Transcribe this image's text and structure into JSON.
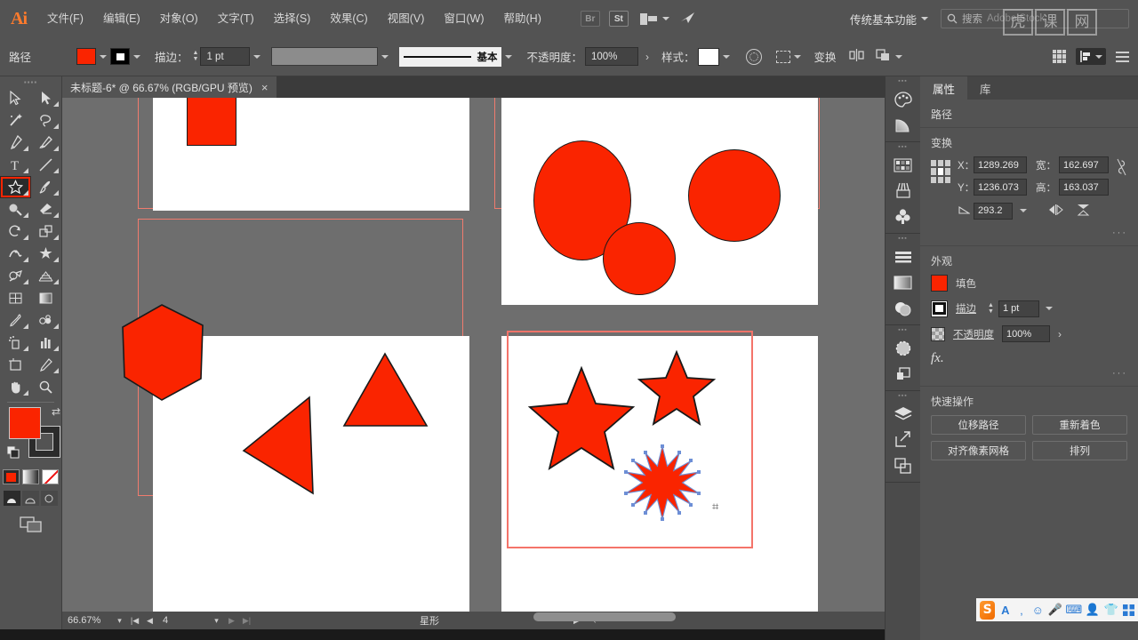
{
  "app": {
    "name": "Ai",
    "workspace": "传统基本功能",
    "watermark": [
      "虎",
      "课",
      "网"
    ]
  },
  "menubar": {
    "items": [
      {
        "label": "文件(F)"
      },
      {
        "label": "编辑(E)"
      },
      {
        "label": "对象(O)"
      },
      {
        "label": "文字(T)"
      },
      {
        "label": "选择(S)"
      },
      {
        "label": "效果(C)"
      },
      {
        "label": "视图(V)"
      },
      {
        "label": "窗口(W)"
      },
      {
        "label": "帮助(H)"
      }
    ],
    "apps": [
      {
        "name": "bridge-icon",
        "label": "Br"
      },
      {
        "name": "stock-icon",
        "label": "St"
      }
    ],
    "search": {
      "label": "搜索",
      "hint": "Adobe Stock"
    }
  },
  "controlbar": {
    "object_type": "路径",
    "fill_color": "#fa2400",
    "stroke_label": "描边：",
    "stroke_weight": "1 pt",
    "stroke_profile_placeholder": "",
    "stroke_style_name": "基本",
    "opacity_label": "不透明度：",
    "opacity_value": "100%",
    "style_label": "样式：",
    "transform_label": "变换",
    "icons": [
      "recolor-artwork-icon",
      "artboard-icon",
      "align-icon",
      "arrange-icon",
      "grid-icon",
      "align-panel-icon",
      "options-menu-icon"
    ]
  },
  "document": {
    "tab_title": "未标题-6* @ 66.67% (RGB/GPU 预览)",
    "close_label": "×"
  },
  "toolbar": {
    "tools": [
      {
        "name": "selection-tool",
        "glyph": "arrow"
      },
      {
        "name": "direct-selection-tool",
        "glyph": "arrow-white"
      },
      {
        "name": "magic-wand-tool",
        "glyph": "wand"
      },
      {
        "name": "lasso-tool",
        "glyph": "lasso"
      },
      {
        "name": "pen-tool",
        "glyph": "pen"
      },
      {
        "name": "curvature-tool",
        "glyph": "curvature"
      },
      {
        "name": "type-tool",
        "glyph": "T"
      },
      {
        "name": "line-segment-tool",
        "glyph": "line"
      },
      {
        "name": "star-tool",
        "glyph": "star",
        "selected": true
      },
      {
        "name": "paintbrush-tool",
        "glyph": "brush"
      },
      {
        "name": "shaper-tool",
        "glyph": "shaper"
      },
      {
        "name": "eraser-tool",
        "glyph": "eraser"
      },
      {
        "name": "rotate-tool",
        "glyph": "rotate"
      },
      {
        "name": "scale-tool",
        "glyph": "scale"
      },
      {
        "name": "width-tool",
        "glyph": "width"
      },
      {
        "name": "free-transform-tool",
        "glyph": "freetransform"
      },
      {
        "name": "shape-builder-tool",
        "glyph": "shapebuilder"
      },
      {
        "name": "perspective-grid-tool",
        "glyph": "perspective"
      },
      {
        "name": "mesh-tool",
        "glyph": "mesh"
      },
      {
        "name": "gradient-tool",
        "glyph": "gradient"
      },
      {
        "name": "eyedropper-tool",
        "glyph": "eyedropper"
      },
      {
        "name": "blend-tool",
        "glyph": "blend"
      },
      {
        "name": "symbol-sprayer-tool",
        "glyph": "symbolsprayer"
      },
      {
        "name": "column-graph-tool",
        "glyph": "graph"
      },
      {
        "name": "artboard-tool",
        "glyph": "artboard"
      },
      {
        "name": "slice-tool",
        "glyph": "slice"
      },
      {
        "name": "hand-tool",
        "glyph": "hand"
      },
      {
        "name": "zoom-tool",
        "glyph": "zoom"
      }
    ],
    "fill_color": "#fa2400",
    "stroke_color": "#000000",
    "color_modes": [
      "color-swatch",
      "gradient-swatch",
      "none-swatch"
    ],
    "draw_modes": [
      "draw-normal",
      "draw-behind",
      "draw-inside"
    ],
    "screen_mode": "change-screen-mode"
  },
  "canvas": {
    "artboards": [
      {
        "name": "artboard-1-squares",
        "shapes": [
          {
            "type": "square",
            "name": "red-square"
          }
        ]
      },
      {
        "name": "artboard-2-ellipses",
        "shapes": [
          {
            "type": "ellipse",
            "name": "red-ellipse-large"
          },
          {
            "type": "circle",
            "name": "red-circle-small"
          },
          {
            "type": "circle",
            "name": "red-circle-right"
          }
        ]
      },
      {
        "name": "artboard-3-polygons",
        "shapes": [
          {
            "type": "hexagon",
            "name": "red-hexagon"
          },
          {
            "type": "triangle-left",
            "name": "red-triangle-left"
          },
          {
            "type": "triangle-up",
            "name": "red-triangle-up"
          }
        ]
      },
      {
        "name": "artboard-4-stars",
        "active": true,
        "shapes": [
          {
            "type": "star-5",
            "name": "red-star-large"
          },
          {
            "type": "star-5",
            "name": "red-star-small"
          },
          {
            "type": "star-11",
            "name": "red-starburst-selected",
            "selected": true
          }
        ]
      }
    ],
    "artboard_guide_color": "#f07b6e",
    "shape_fill": "#fa2400",
    "shape_stroke": "#1a1a1a",
    "background": "#6e6e6e"
  },
  "statusbar": {
    "zoom": "66.67%",
    "page": "4",
    "tool_name": "星形"
  },
  "rail": {
    "groups": [
      {
        "icons": [
          {
            "name": "color-panel-icon"
          },
          {
            "name": "gradient-panel-icon"
          }
        ]
      },
      {
        "icons": [
          {
            "name": "swatches-panel-icon"
          },
          {
            "name": "brushes-panel-icon"
          },
          {
            "name": "symbols-panel-icon"
          }
        ]
      },
      {
        "icons": [
          {
            "name": "align-panel-icon"
          },
          {
            "name": "transparency-panel-icon"
          },
          {
            "name": "appearance-panel-icon"
          }
        ]
      },
      {
        "icons": [
          {
            "name": "stroke-panel-icon"
          },
          {
            "name": "pathfinder-panel-icon"
          }
        ]
      },
      {
        "icons": [
          {
            "name": "layers-panel-icon"
          },
          {
            "name": "asset-export-panel-icon"
          },
          {
            "name": "artboards-panel-icon"
          }
        ]
      }
    ]
  },
  "properties": {
    "tabs": [
      {
        "label": "属性",
        "active": true
      },
      {
        "label": "库",
        "active": false
      }
    ],
    "object_type": "路径",
    "transform": {
      "title": "变换",
      "x_label": "X：",
      "x_value": "1289.269",
      "y_label": "Y：",
      "y_value": "1236.073",
      "w_label": "宽：",
      "w_value": "162.697",
      "h_label": "高：",
      "h_value": "163.037",
      "angle_value": "293.2",
      "more_label": "···"
    },
    "appearance": {
      "title": "外观",
      "fill_label": "填色",
      "fill_color": "#fa2400",
      "stroke_label": "描边",
      "stroke_weight": "1 pt",
      "opacity_label": "不透明度",
      "opacity_value": "100%",
      "fx_label": "fx.",
      "more_label": "···"
    },
    "quick_actions": {
      "title": "快速操作",
      "buttons": [
        {
          "label": "位移路径",
          "name": "offset-path-button"
        },
        {
          "label": "重新着色",
          "name": "recolor-button"
        },
        {
          "label": "对齐像素网格",
          "name": "align-pixel-grid-button"
        },
        {
          "label": "排列",
          "name": "arrange-button"
        }
      ]
    }
  },
  "ime": {
    "icons": [
      "sogou-logo",
      "input-mode-icon",
      "comma-icon",
      "emoji-icon",
      "voice-icon",
      "keyboard-icon",
      "user-icon",
      "skin-icon",
      "apps-icon"
    ]
  }
}
